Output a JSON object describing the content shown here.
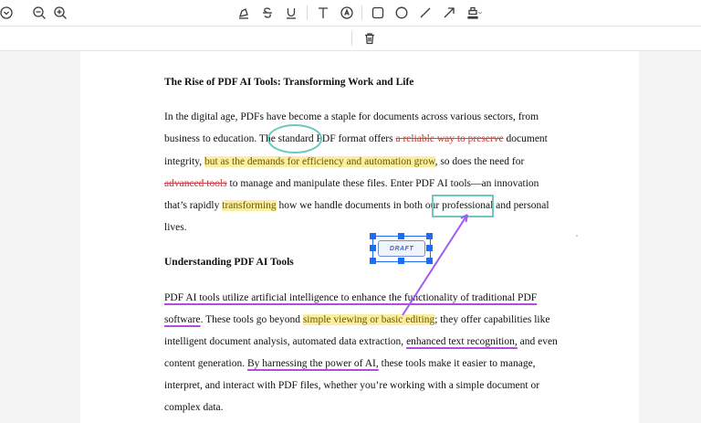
{
  "toolbar": {
    "icons": [
      "collapse-icon",
      "zoom-out-icon",
      "zoom-in-icon",
      "highlight-icon",
      "strikethrough-icon",
      "underline-icon",
      "text-icon",
      "stamp-circle-icon",
      "rectangle-icon",
      "ellipse-icon",
      "line-icon",
      "arrow-icon",
      "fill-icon"
    ]
  },
  "subbar": {
    "icons": [
      "trash-icon"
    ]
  },
  "document": {
    "title": "The Rise of PDF AI Tools: Transforming Work and Life",
    "p1": {
      "l1": "In the digital age, PDFs have become a staple for documents across various sectors, from",
      "l2a": "business to education. The standard PDF format offers ",
      "l2b": "a reliable way to preserve",
      "l2c": " document",
      "l3a": "integrity, ",
      "l3b": "but as the demands for efficiency and automation grow",
      "l3c": ", so does the need for",
      "l4a": "advanced tools",
      "l4b": " to manage and manipulate these files. Enter PDF AI tools—an innovation",
      "l5a": "that’s rapidly ",
      "l5b": "transforming",
      "l5c": " how we handle documents in both our professional and personal",
      "l6": "lives."
    },
    "heading2": "Understanding PDF AI Tools",
    "p2": {
      "l1": "PDF AI tools utilize artificial intelligence to enhance the functionality of traditional PDF",
      "l2a": "software",
      "l2b": ". These tools go beyond ",
      "l2c": "simple viewing or basic editing",
      "l2d": "; they offer capabilities like",
      "l3a": "intelligent document analysis, automated data extraction, ",
      "l3b": "enhanced text recognition,",
      "l3c": " and even",
      "l4a": "content generation. ",
      "l4b": "By harnessing the power of AI,",
      "l4c": " these tools make it easier to manage,",
      "l5": "interpret, and interact with PDF files, whether you’re working with a simple document or",
      "l6": "complex data."
    },
    "stamp_label": "DRAFT"
  },
  "colors": {
    "highlight": "#fbeea0",
    "strikethrough": "#d0455b",
    "underline": "#b04ed8",
    "ellipse": "#6ec7c0",
    "rectangle": "#6ec7c0",
    "arrow": "#a05cf0",
    "selection": "#1e6cf0"
  }
}
